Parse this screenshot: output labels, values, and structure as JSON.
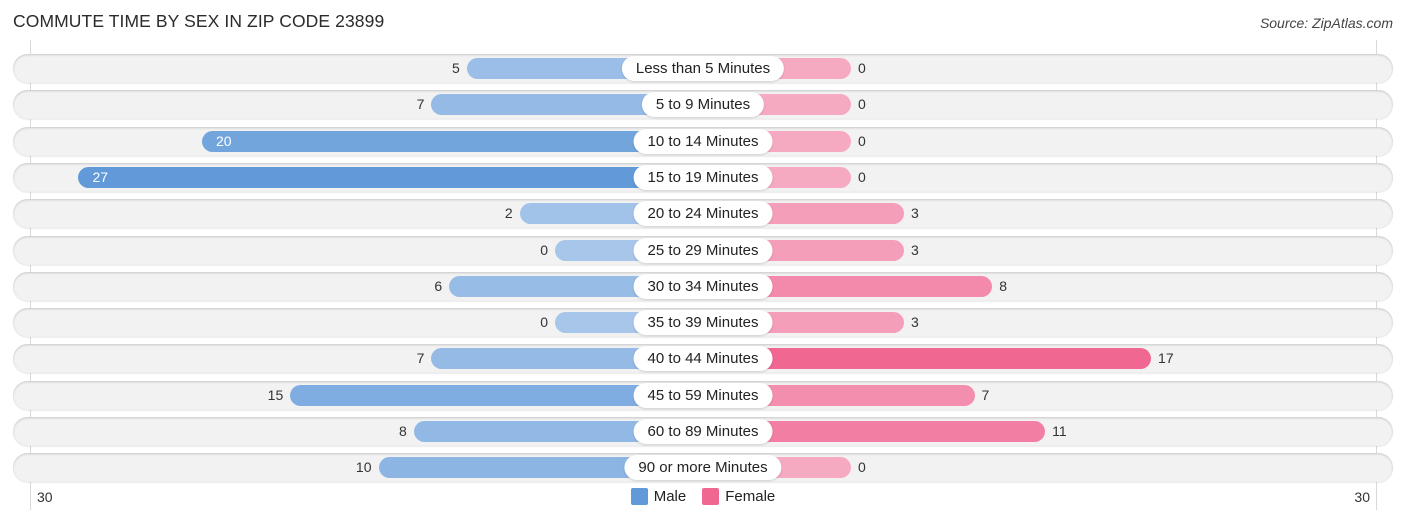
{
  "title": "COMMUTE TIME BY SEX IN ZIP CODE 23899",
  "source": "Source: ZipAtlas.com",
  "colors": {
    "male_strong": "#6199d9",
    "male_light": "#a7c6ea",
    "female_strong": "#f06792",
    "female_light": "#f6aac2",
    "track": "#f2f2f2"
  },
  "chart_data": {
    "type": "bar",
    "orientation": "horizontal-diverging",
    "title": "COMMUTE TIME BY SEX IN ZIP CODE 23899",
    "categories": [
      "Less than 5 Minutes",
      "5 to 9 Minutes",
      "10 to 14 Minutes",
      "15 to 19 Minutes",
      "20 to 24 Minutes",
      "25 to 29 Minutes",
      "30 to 34 Minutes",
      "35 to 39 Minutes",
      "40 to 44 Minutes",
      "45 to 59 Minutes",
      "60 to 89 Minutes",
      "90 or more Minutes"
    ],
    "series": [
      {
        "name": "Male",
        "values": [
          5,
          7,
          20,
          27,
          2,
          0,
          6,
          0,
          7,
          15,
          8,
          10
        ]
      },
      {
        "name": "Female",
        "values": [
          0,
          0,
          0,
          0,
          3,
          3,
          8,
          3,
          17,
          7,
          11,
          0
        ]
      }
    ],
    "axis": {
      "left_tick": "30",
      "right_tick": "30",
      "range": [
        30,
        30
      ]
    },
    "legend": {
      "position": "bottom-center",
      "entries": [
        "Male",
        "Female"
      ]
    },
    "xlabel": "",
    "ylabel": ""
  }
}
